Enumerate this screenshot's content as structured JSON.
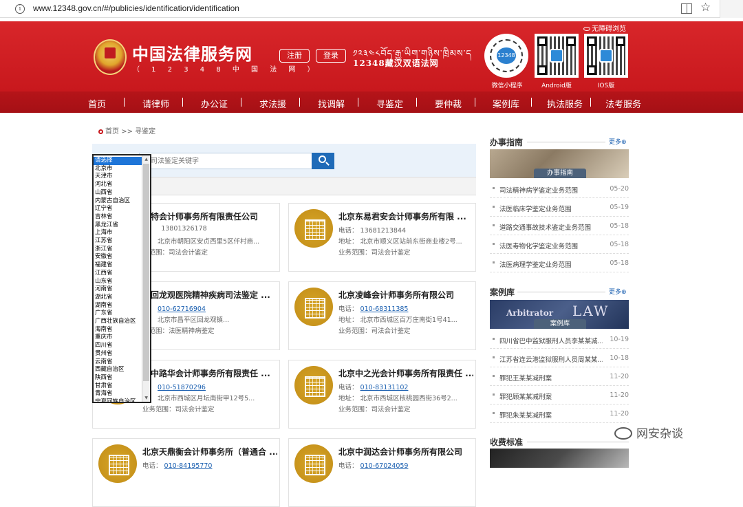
{
  "browser": {
    "url": "www.12348.gov.cn/#/publicies/identification/identification"
  },
  "header": {
    "site_title": "中国法律服务网",
    "site_subtitle": "（ 1 2 3 4 8 中 国 法 网 ）",
    "register_label": "注册",
    "login_label": "登录",
    "tibetan_title": "༡༢༣༤༨བོད་རྒྱ་ཡིག་གཉིས་ཁྲིམས་ད",
    "tibetan_subtitle": "12348藏汉双语法网",
    "accessibility_label": "无障碍浏览",
    "qr": [
      {
        "label": "微信小程序",
        "center": "12348"
      },
      {
        "label": "Android版"
      },
      {
        "label": "IOS版"
      }
    ]
  },
  "nav": {
    "items": [
      "首页",
      "请律师",
      "办公证",
      "求法援",
      "找调解",
      "寻鉴定",
      "要仲裁",
      "案例库",
      "执法服务",
      "法考服务"
    ]
  },
  "breadcrumb": {
    "home": "首页",
    "separator": ">>",
    "current": "寻鉴定"
  },
  "search": {
    "placeholder": "入司法鉴定关键字"
  },
  "province_list": {
    "items": [
      "请选择",
      "北京市",
      "天津市",
      "河北省",
      "山西省",
      "内蒙古自治区",
      "辽宁省",
      "吉林省",
      "黑龙江省",
      "上海市",
      "江苏省",
      "浙江省",
      "安徽省",
      "福建省",
      "江西省",
      "山东省",
      "河南省",
      "湖北省",
      "湖南省",
      "广东省",
      "广西壮族自治区",
      "海南省",
      "重庆市",
      "四川省",
      "贵州省",
      "云南省",
      "西藏自治区",
      "陕西省",
      "甘肃省",
      "青海省",
      "宁夏回族自治区"
    ],
    "selected": "请选择"
  },
  "cards": [
    {
      "name": "迪特会计师事务所有限责任公司",
      "phone_label": "",
      "phone": "13801326178",
      "phone_plain": true,
      "addr_label": "址：",
      "addr": "北京市朝阳区安贞西里5区仟村商...",
      "scope_label": "务范围：",
      "scope": "司法会计鉴定"
    },
    {
      "name": "北京东易君安会计师事务所有限 ...",
      "phone_label": "电话：",
      "phone": "13681213844",
      "phone_plain": true,
      "addr_label": "地址：",
      "addr": "北京市顺义区站前东街商业楼2号...",
      "scope_label": "业务范围：",
      "scope": "司法会计鉴定"
    },
    {
      "name": "京回龙观医院精神疾病司法鉴定 ...",
      "phone_label": "话：",
      "phone": "010-62716904",
      "phone_plain": false,
      "addr_label": "址：",
      "addr": "北京市昌平区回龙观镇...",
      "scope_label": "务范围：",
      "scope": "法医精神病鉴定"
    },
    {
      "name": "北京凌峰会计师事务所有限公司",
      "phone_label": "电话：",
      "phone": "010-68311385",
      "phone_plain": false,
      "addr_label": "地址：",
      "addr": "北京市西城区百万庄南街1号41...",
      "scope_label": "业务范围：",
      "scope": "司法会计鉴定"
    },
    {
      "name": "京中路华会计师事务所有限责任 ...",
      "phone_label": "话：",
      "phone": "010-51870296",
      "phone_plain": false,
      "addr_label": "址：",
      "addr": "北京市西城区月坛南街甲12号5...",
      "scope_label": "业务范围：",
      "scope": "司法会计鉴定"
    },
    {
      "name": "北京中之光会计师事务所有限责任 ...",
      "phone_label": "电话：",
      "phone": "010-83131102",
      "phone_plain": false,
      "addr_label": "地址：",
      "addr": "北京市西城区核桃园西街36号2...",
      "scope_label": "业务范围：",
      "scope": "司法会计鉴定"
    },
    {
      "name": "北京天鼎衡会计师事务所（普通合 ...",
      "phone_label": "电话：",
      "phone": "010-84195770",
      "phone_plain": false
    },
    {
      "name": "北京中润达会计师事务所有限公司",
      "phone_label": "电话：",
      "phone": "010-67024059",
      "phone_plain": false
    }
  ],
  "sidebar": {
    "guide": {
      "title": "办事指南",
      "more": "更多⊕",
      "banner_caption": "办事指南",
      "items": [
        {
          "title": "司法精神病学鉴定业务范围",
          "date": "05-20"
        },
        {
          "title": "法医临床学鉴定业务范围",
          "date": "05-19"
        },
        {
          "title": "道路交通事故技术鉴定业务范围",
          "date": "05-18"
        },
        {
          "title": "法医毒物化学鉴定业务范围",
          "date": "05-18"
        },
        {
          "title": "法医病理学鉴定业务范围",
          "date": "05-18"
        }
      ]
    },
    "cases": {
      "title": "案例库",
      "more": "更多⊕",
      "banner_caption": "案例库",
      "banner_text_a": "Arbitrator",
      "banner_text_b": "LAW",
      "items": [
        {
          "title": "四川省巴中监狱服刑人员李某某减...",
          "date": "10-19"
        },
        {
          "title": "江苏省连云港监狱服刑人员周某某...",
          "date": "10-18"
        },
        {
          "title": "罪犯王某某减刑案",
          "date": "11-20"
        },
        {
          "title": "罪犯顾某某减刑案",
          "date": "11-20"
        },
        {
          "title": "罪犯朱某某减刑案",
          "date": "11-20"
        }
      ]
    },
    "fees": {
      "title": "收费标准"
    }
  },
  "watermark": "网安杂谈"
}
